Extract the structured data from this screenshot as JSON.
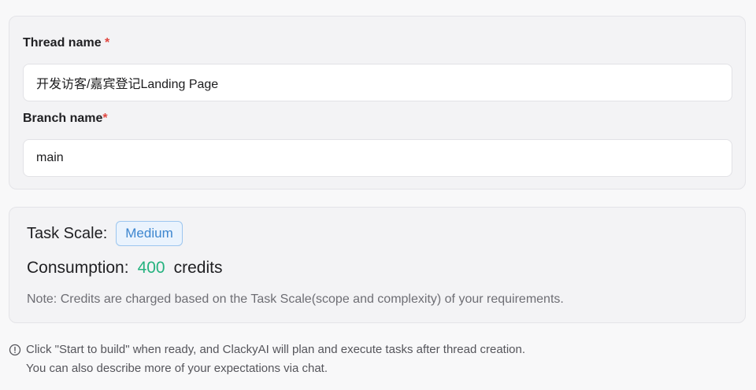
{
  "form": {
    "thread_label": "Thread name",
    "thread_required_mark": "*",
    "thread_value": "开发访客/嘉宾登记Landing Page",
    "branch_label": "Branch name",
    "branch_required_mark": "*",
    "branch_value": "main"
  },
  "scale": {
    "label": "Task Scale:",
    "badge": "Medium",
    "consumption_label": "Consumption:",
    "credits_value": "400",
    "credits_unit": "credits",
    "note": "Note: Credits are charged based on the Task Scale(scope and complexity) of your requirements."
  },
  "info": {
    "icon": "info-circle-icon",
    "line1": "Click \"Start to build\" when ready, and ClackyAI will plan and execute tasks after thread creation.",
    "line2": "You can also describe more of your expectations via chat."
  },
  "colors": {
    "accent_badge": "#3d86cf",
    "credits_green": "#25b27f",
    "required_red": "#e0463f"
  }
}
